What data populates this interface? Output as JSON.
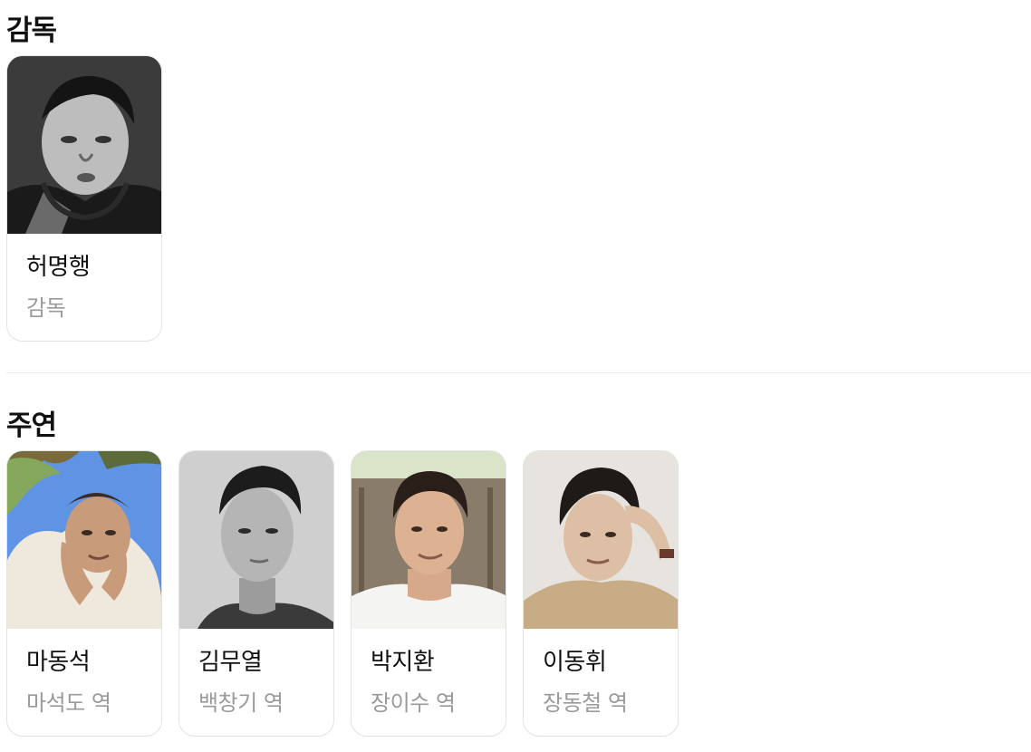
{
  "director_section": {
    "title": "감독",
    "people": [
      {
        "name": "허명행",
        "role": "감독",
        "photo": "director-portrait"
      }
    ]
  },
  "cast_section": {
    "title": "주연",
    "people": [
      {
        "name": "마동석",
        "role": "마석도 역",
        "photo": "actor-portrait-blue-sky"
      },
      {
        "name": "김무열",
        "role": "백창기 역",
        "photo": "actor-portrait-grayscale"
      },
      {
        "name": "박지환",
        "role": "장이수 역",
        "photo": "actor-portrait-outdoor"
      },
      {
        "name": "이동휘",
        "role": "장동철 역",
        "photo": "actor-portrait-beige"
      }
    ]
  },
  "colors": {
    "name_text": "#111111",
    "role_text": "#9a9a9a",
    "card_border": "#e3e3e3",
    "divider": "#ececec"
  }
}
